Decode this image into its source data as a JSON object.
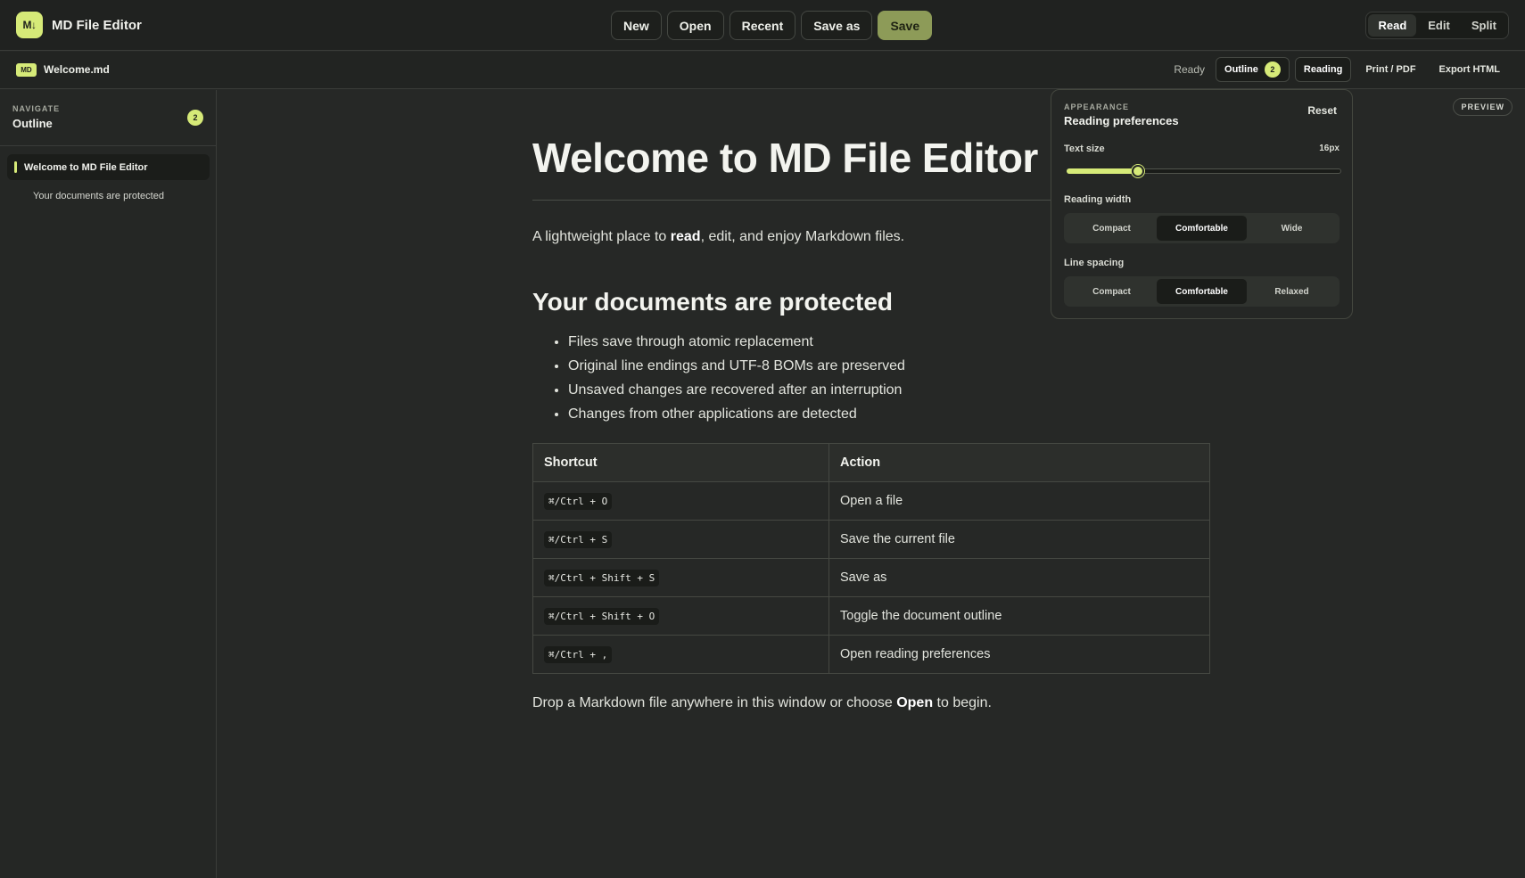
{
  "app": {
    "logo_text": "M↓",
    "title": "MD File Editor"
  },
  "toolbar": {
    "buttons": [
      {
        "label": "New",
        "primary": false
      },
      {
        "label": "Open",
        "primary": false
      },
      {
        "label": "Recent",
        "primary": false
      },
      {
        "label": "Save as",
        "primary": false
      },
      {
        "label": "Save",
        "primary": true
      }
    ]
  },
  "modes": {
    "items": [
      "Read",
      "Edit",
      "Split"
    ],
    "active": "Read"
  },
  "file": {
    "badge": "MD",
    "name": "Welcome.md"
  },
  "subbar": {
    "status": "Ready",
    "outline_label": "Outline",
    "outline_count": "2",
    "reading_label": "Reading",
    "print_label": "Print / PDF",
    "export_label": "Export HTML"
  },
  "sidebar": {
    "eyebrow": "NAVIGATE",
    "title": "Outline",
    "count": "2",
    "items": [
      {
        "label": "Welcome to MD File Editor",
        "level": 1,
        "active": true
      },
      {
        "label": "Your documents are protected",
        "level": 2,
        "active": false
      }
    ]
  },
  "preview_tag": "PREVIEW",
  "document": {
    "title": "Welcome to MD File Editor",
    "intro": {
      "before": "A lightweight place to ",
      "bold": "read",
      "after": ", edit, and enjoy Markdown files."
    },
    "heading2": "Your documents are protected",
    "list": [
      "Files save through atomic replacement",
      "Original line endings and UTF-8 BOMs are preserved",
      "Unsaved changes are recovered after an interruption",
      "Changes from other applications are detected"
    ],
    "table": {
      "headers": [
        "Shortcut",
        "Action"
      ],
      "rows": [
        {
          "shortcut": "⌘/Ctrl + O",
          "action": "Open a file"
        },
        {
          "shortcut": "⌘/Ctrl + S",
          "action": "Save the current file"
        },
        {
          "shortcut": "⌘/Ctrl + Shift + S",
          "action": "Save as"
        },
        {
          "shortcut": "⌘/Ctrl + Shift + O",
          "action": "Toggle the document outline"
        },
        {
          "shortcut": "⌘/Ctrl + ,",
          "action": "Open reading preferences"
        }
      ]
    },
    "outro": {
      "before": "Drop a Markdown file anywhere in this window or choose ",
      "bold": "Open",
      "after": " to begin."
    }
  },
  "preferences": {
    "eyebrow": "APPEARANCE",
    "title": "Reading preferences",
    "reset_label": "Reset",
    "text_size": {
      "label": "Text size",
      "value_text": "16px",
      "fraction": 0.26
    },
    "reading_width": {
      "label": "Reading width",
      "options": [
        "Compact",
        "Comfortable",
        "Wide"
      ],
      "active": "Comfortable"
    },
    "line_spacing": {
      "label": "Line spacing",
      "options": [
        "Compact",
        "Comfortable",
        "Relaxed"
      ],
      "active": "Comfortable"
    }
  },
  "colors": {
    "accent": "#d6ea78",
    "save_button": "#8d9b58",
    "background": "#262826"
  }
}
